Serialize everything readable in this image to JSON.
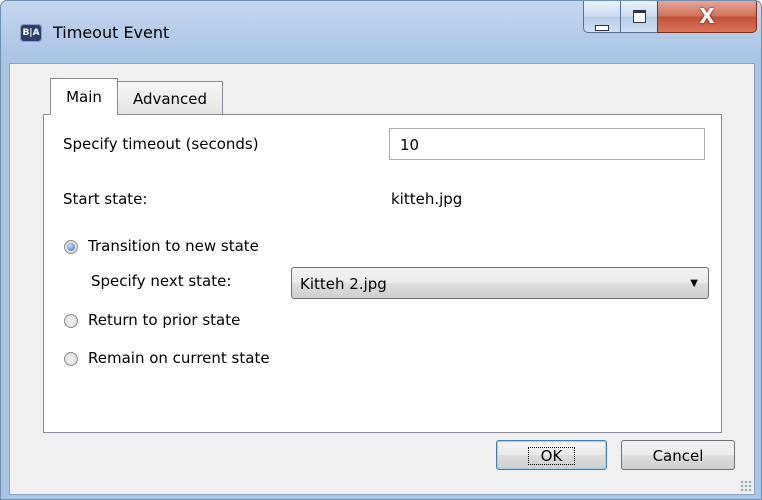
{
  "window": {
    "title": "Timeout Event",
    "icon_text": "B|A",
    "close_glyph": "X"
  },
  "tabs": [
    {
      "label": "Main",
      "active": true
    },
    {
      "label": "Advanced",
      "active": false
    }
  ],
  "main": {
    "timeout_label": "Specify timeout (seconds)",
    "timeout_value": "10",
    "start_state_label": "Start state:",
    "start_state_value": "kitteh.jpg",
    "options": [
      {
        "label": "Transition to new state",
        "selected": true
      },
      {
        "label": "Return to prior state",
        "selected": false
      },
      {
        "label": "Remain on current state",
        "selected": false
      }
    ],
    "next_state_label": "Specify next state:",
    "next_state_value": "Kitteh 2.jpg"
  },
  "buttons": {
    "ok": "OK",
    "cancel": "Cancel"
  },
  "icons": {
    "dropdown": "chevron-down-icon",
    "minimize": "minimize-icon",
    "maximize": "maximize-icon",
    "close": "close-icon"
  }
}
